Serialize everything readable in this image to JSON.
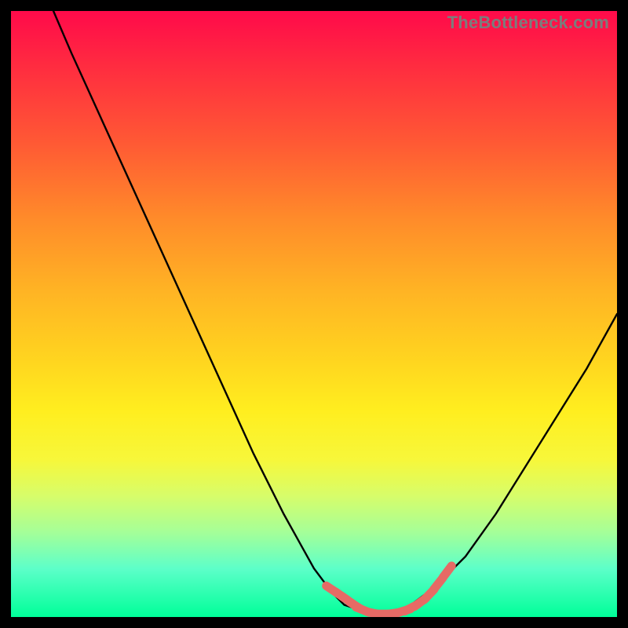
{
  "watermark": "TheBottleneck.com",
  "colors": {
    "background": "#000000",
    "curve": "#000000",
    "marker": "#e66a65",
    "gradient_top": "#ff0a4a",
    "gradient_bottom": "#00ff99"
  },
  "chart_data": {
    "type": "line",
    "title": "",
    "xlabel": "",
    "ylabel": "",
    "xlim": [
      0,
      100
    ],
    "ylim": [
      0,
      100
    ],
    "grid": false,
    "legend": false,
    "series": [
      {
        "name": "bottleneck-curve",
        "x": [
          7,
          10,
          15,
          20,
          25,
          30,
          35,
          40,
          45,
          50,
          53,
          55,
          58,
          60,
          62,
          64,
          66,
          70,
          75,
          80,
          85,
          90,
          95,
          100
        ],
        "y": [
          100,
          93,
          82,
          71,
          60,
          49,
          38,
          27,
          17,
          8,
          4,
          2,
          1,
          0.5,
          0.5,
          1,
          2,
          5,
          10,
          17,
          25,
          33,
          41,
          50
        ]
      }
    ],
    "markers": {
      "name": "highlighted-points",
      "points": [
        {
          "x": 53,
          "y": 4.5
        },
        {
          "x": 54.5,
          "y": 3.5
        },
        {
          "x": 55.5,
          "y": 2.8
        },
        {
          "x": 56.8,
          "y": 1.9
        },
        {
          "x": 58,
          "y": 1.2
        },
        {
          "x": 60,
          "y": 0.6
        },
        {
          "x": 61.5,
          "y": 0.5
        },
        {
          "x": 63,
          "y": 0.6
        },
        {
          "x": 64.8,
          "y": 1.0
        },
        {
          "x": 66,
          "y": 1.5
        },
        {
          "x": 67.5,
          "y": 2.4
        },
        {
          "x": 69,
          "y": 3.7
        },
        {
          "x": 70.5,
          "y": 5.5
        },
        {
          "x": 72,
          "y": 7.5
        }
      ]
    }
  }
}
